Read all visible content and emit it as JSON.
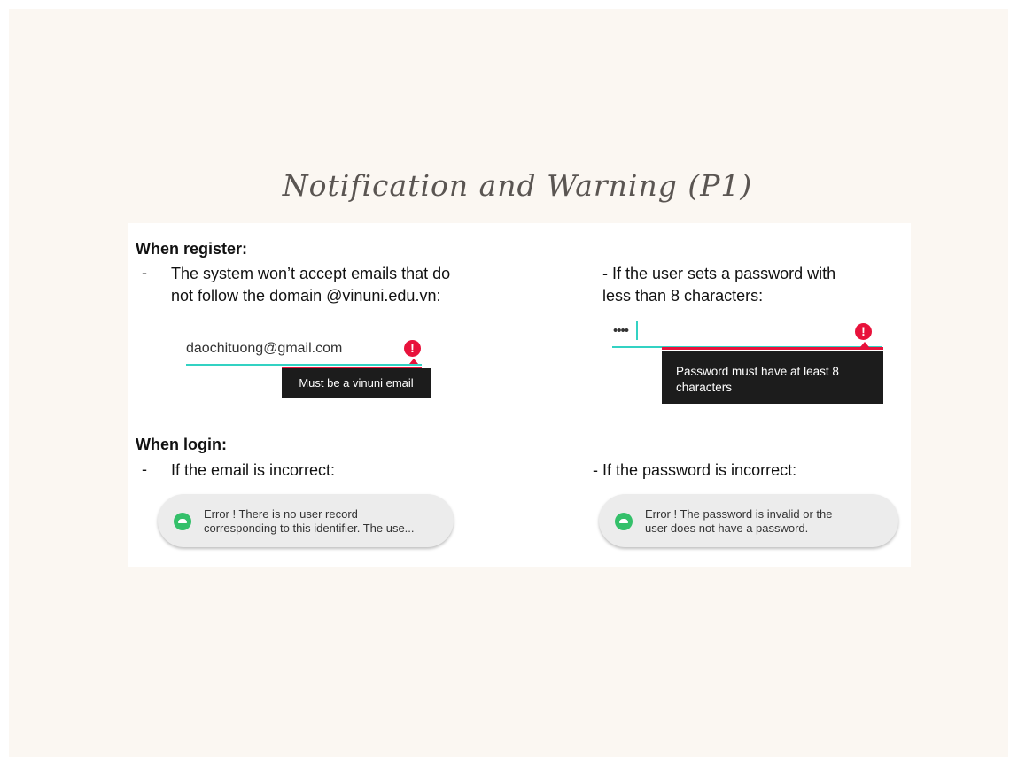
{
  "slide": {
    "title": "Notification and Warning (P1)"
  },
  "register": {
    "heading": "When register:",
    "email_rule": {
      "bullet": "-",
      "line1": "The system won’t accept emails that do",
      "line2": "not follow the domain @vinuni.edu.vn:"
    },
    "email_field": {
      "value": "daochituong@gmail.com",
      "error_icon": "exclamation-icon",
      "error_tooltip": "Must be a vinuni email"
    },
    "password_rule": {
      "line1": "- If the user sets a password with",
      "line2": "less than 8 characters:"
    },
    "password_field": {
      "value": "••••",
      "error_icon": "exclamation-icon",
      "error_tooltip_line1": "Password must have at least 8",
      "error_tooltip_line2": "characters"
    }
  },
  "login": {
    "heading": "When login:",
    "email_rule": {
      "bullet": "-",
      "text": "If the email is incorrect:"
    },
    "email_toast": {
      "icon": "android-icon",
      "text": "Error ! There is no user record\ncorresponding to this identifier. The use..."
    },
    "password_rule": {
      "text": "- If the password is incorrect:"
    },
    "password_toast": {
      "icon": "android-icon",
      "text": "Error ! The password is invalid or the\nuser does not have a password."
    }
  },
  "colors": {
    "accent_teal": "#33d2c3",
    "error_red": "#e8123b",
    "tooltip_bg": "#1c1c1c",
    "toast_icon_green": "#34c06a",
    "slide_bg": "#fbf7f2"
  }
}
